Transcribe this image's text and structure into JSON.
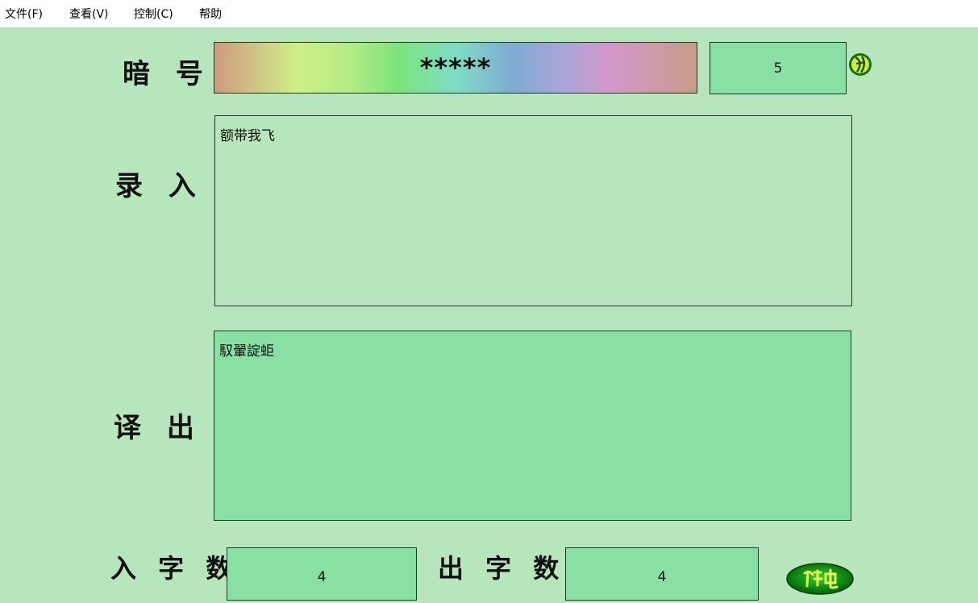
{
  "menu": [
    "文件(F)",
    "查看(V)",
    "控制(C)",
    "帮助"
  ],
  "labels": {
    "password": "暗 号",
    "input": "录 入",
    "output": "译 出",
    "input_count": "入 字 数",
    "output_count": "出 字 数"
  },
  "password": {
    "masked_value": "*****",
    "length": "5"
  },
  "icons": {
    "corner": "knot-emblem-icon",
    "action": "green-oval-translate-icon"
  },
  "input_text": "额带我飞",
  "output_text": "馭翬諚蚷",
  "stats": {
    "input_count": "4",
    "output_count": "4"
  },
  "colors": {
    "background": "#b7e6bd",
    "field": "#88e0a4",
    "border": "#1d3a22",
    "button": "#0a7a12"
  }
}
